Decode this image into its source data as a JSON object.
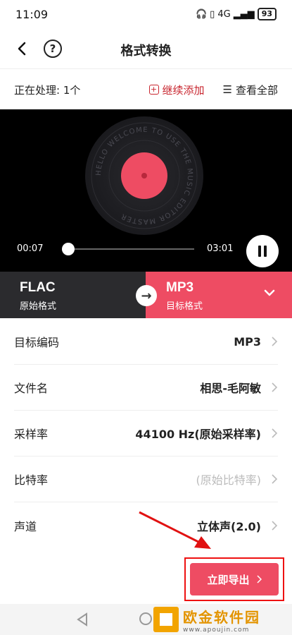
{
  "status_bar": {
    "time": "11:09",
    "signal": "4G",
    "battery": "93"
  },
  "header": {
    "title": "格式转换"
  },
  "process": {
    "label": "正在处理: 1个",
    "add_label": "继续添加",
    "view_all_label": "查看全部"
  },
  "player": {
    "current_time": "00:07",
    "total_time": "03:01",
    "progress": 0.04,
    "record_text": "HELLO WELCOME TO USE THE MUSIC EDITOR MASTER"
  },
  "format": {
    "source_name": "FLAC",
    "source_sub": "原始格式",
    "target_name": "MP3",
    "target_sub": "目标格式"
  },
  "settings": [
    {
      "label": "目标编码",
      "value": "MP3",
      "placeholder": false
    },
    {
      "label": "文件名",
      "value": "相思-毛阿敏",
      "placeholder": false
    },
    {
      "label": "采样率",
      "value": "44100 Hz(原始采样率)",
      "placeholder": false
    },
    {
      "label": "比特率",
      "value": "(原始比特率)",
      "placeholder": true
    },
    {
      "label": "声道",
      "value": "立体声(2.0)",
      "placeholder": false
    }
  ],
  "export": {
    "label": "立即导出"
  },
  "watermark": {
    "title": "欧金软件园",
    "url": "www.apoujin.com"
  },
  "colors": {
    "accent": "#ee4c63",
    "dark": "#2b2b2e",
    "annotation": "#e11111"
  }
}
